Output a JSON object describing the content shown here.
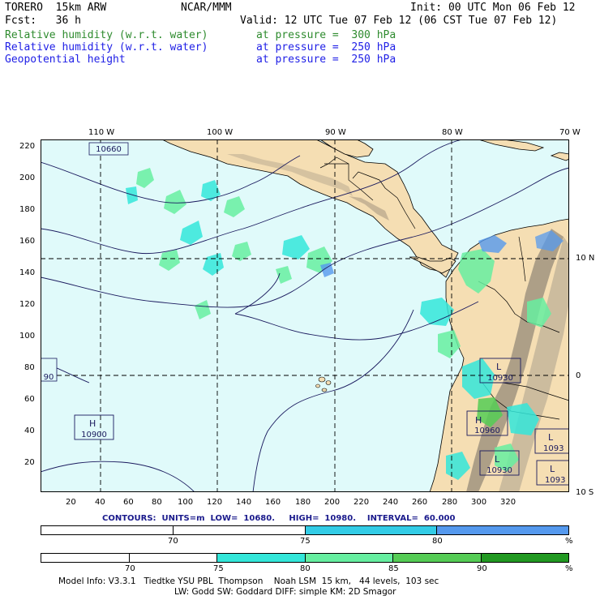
{
  "header": {
    "model": "TORERO  15km ARW",
    "center": "NCAR/MMM",
    "init": "Init: 00 UTC Mon 06 Feb 12",
    "fcst": "Fcst:   36 h",
    "valid": "Valid: 12 UTC Tue 07 Feb 12 (06 CST Tue 07 Feb 12)",
    "fields": [
      {
        "name": "Relative humidity (w.r.t. water)",
        "level": "at pressure =  300 hPa",
        "color": "#2e8b2e"
      },
      {
        "name": "Relative humidity (w.r.t. water)",
        "level": "at pressure =  250 hPa",
        "color": "#1e1ee6"
      },
      {
        "name": "Geopotential height",
        "level": "at pressure =  250 hPa",
        "color": "#1e1ee6"
      }
    ]
  },
  "map": {
    "top_lon_labels": [
      "110 W",
      "100 W",
      "90 W",
      "80 W",
      "70 W"
    ],
    "right_lat_labels": [
      "10 N",
      "0",
      "10 S"
    ],
    "y_ticks": [
      "220",
      "200",
      "180",
      "160",
      "140",
      "120",
      "100",
      "80",
      "60",
      "40",
      "20"
    ],
    "x_ticks": [
      "20",
      "40",
      "60",
      "80",
      "100",
      "120",
      "140",
      "160",
      "180",
      "200",
      "220",
      "240",
      "260",
      "280",
      "300",
      "320"
    ],
    "ocean_color": "#e0fafa",
    "land_color": "#f5deb3",
    "contour_labels": [
      "10660",
      "90",
      "10930",
      "10960",
      "10930",
      "10900",
      "1093",
      "1093"
    ],
    "highs_lows": [
      {
        "type": "L",
        "value": "10930"
      },
      {
        "type": "H",
        "value": "10960"
      },
      {
        "type": "L",
        "value": "10930"
      },
      {
        "type": "H",
        "value": "10900"
      },
      {
        "type": "L",
        "value": "1093"
      },
      {
        "type": "L",
        "value": "1093"
      }
    ]
  },
  "contours_text": "CONTOURS:  UNITS=m  LOW=  10680.     HIGH=  10980.    INTERVAL=  60.000",
  "colorbar1": {
    "labels": [
      "70",
      "75",
      "80",
      "%"
    ],
    "colors": [
      "#ffffff",
      "#ffffff",
      "#33cce6",
      "#5599ee"
    ]
  },
  "colorbar2": {
    "labels": [
      "70",
      "75",
      "80",
      "85",
      "90",
      "%"
    ],
    "colors": [
      "#ffffff",
      "#ffffff",
      "#ffffff",
      "#33e6d9",
      "#66eea0",
      "#55cc55",
      "#229922"
    ]
  },
  "footer": {
    "line1": "Model Info: V3.3.1   Tiedtke YSU PBL  Thompson    Noah LSM  15 km,   44 levels,  103 sec",
    "line2": "LW: Godd SW: Goddard DIFF: simple KM: 2D Smagor"
  }
}
